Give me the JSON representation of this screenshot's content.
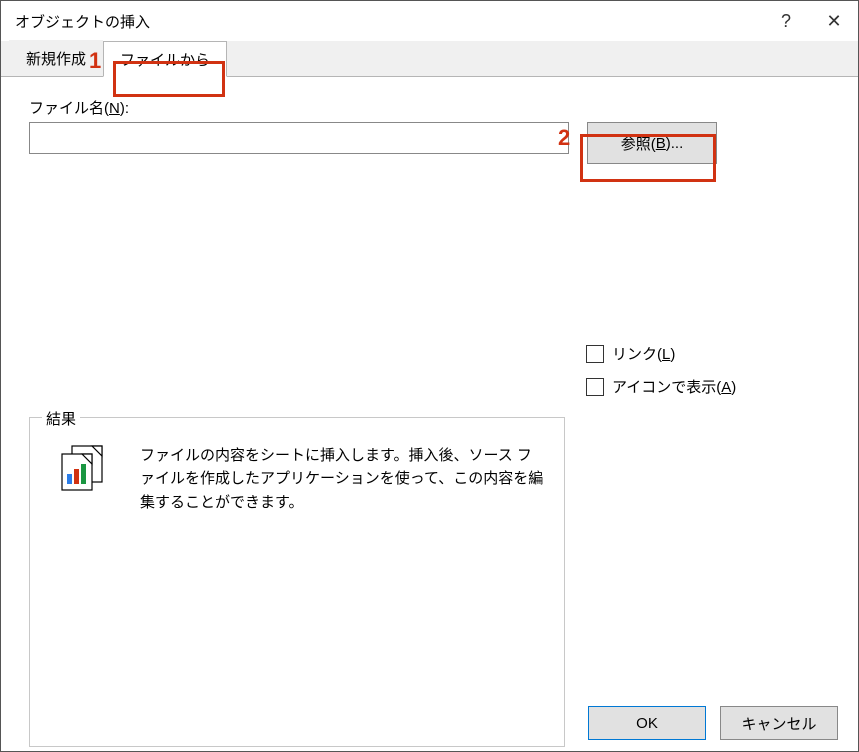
{
  "dialog": {
    "title": "オブジェクトの挿入"
  },
  "tabs": {
    "new": "新規作成",
    "from_file": "ファイルから"
  },
  "file": {
    "label_prefix": "ファイル名(",
    "label_accel": "N",
    "label_suffix": "):",
    "value": "",
    "browse_prefix": "参照(",
    "browse_accel": "B",
    "browse_suffix": ")..."
  },
  "checkboxes": {
    "link_prefix": "リンク(",
    "link_accel": "L",
    "link_suffix": ")",
    "showicon_prefix": "アイコンで表示(",
    "showicon_accel": "A",
    "showicon_suffix": ")"
  },
  "result": {
    "legend": "結果",
    "text": "ファイルの内容をシートに挿入します。挿入後、ソース ファイルを作成したアプリケーションを使って、この内容を編集することができます。"
  },
  "buttons": {
    "ok": "OK",
    "cancel": "キャンセル"
  },
  "annotations": {
    "one": "1",
    "two": "2"
  }
}
